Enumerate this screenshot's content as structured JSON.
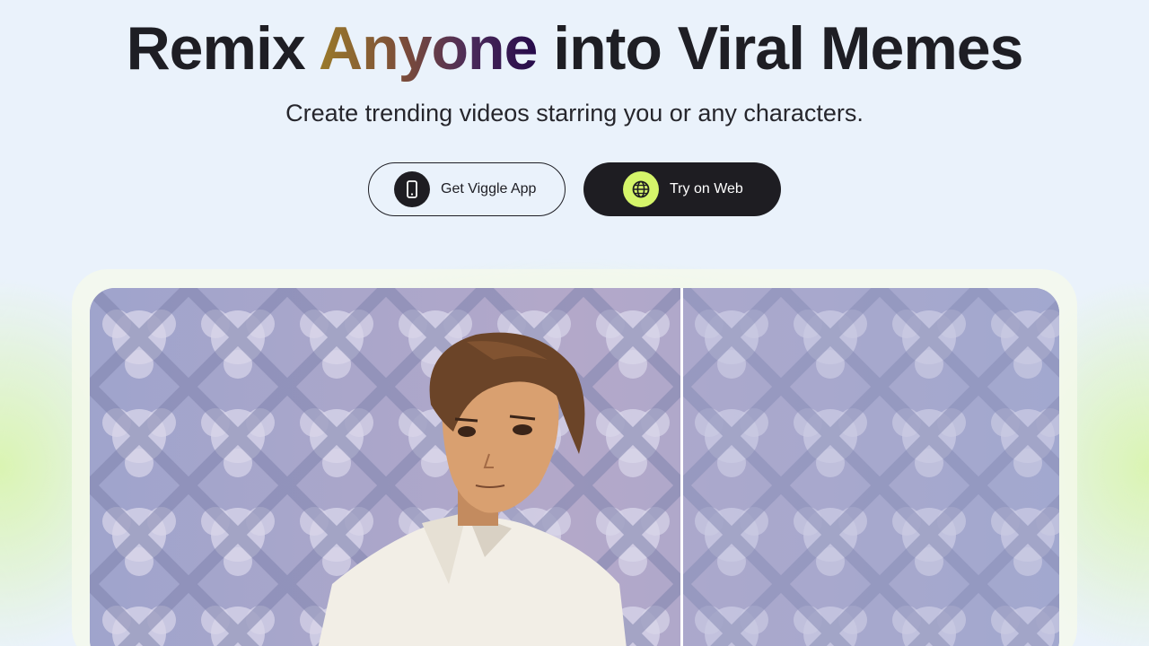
{
  "hero": {
    "title_before": "Remix ",
    "title_accent": "Anyone",
    "title_after": " into Viral Memes",
    "subtitle": "Create trending videos starring you or any characters."
  },
  "actions": {
    "app_label": "Get Viggle App",
    "app_icon": "phone-icon",
    "web_label": "Try on Web",
    "web_icon": "globe-icon"
  },
  "colors": {
    "accent_gradient": [
      "#9a7a2a",
      "#4a2a5a",
      "#260a4a"
    ],
    "dark": "#1e1d22",
    "lime": "#d5f56a",
    "background": "#eaf2fb"
  },
  "media": {
    "content": "anime-character-comparison",
    "left_panel": "anime-character",
    "right_panel": "background-only"
  }
}
